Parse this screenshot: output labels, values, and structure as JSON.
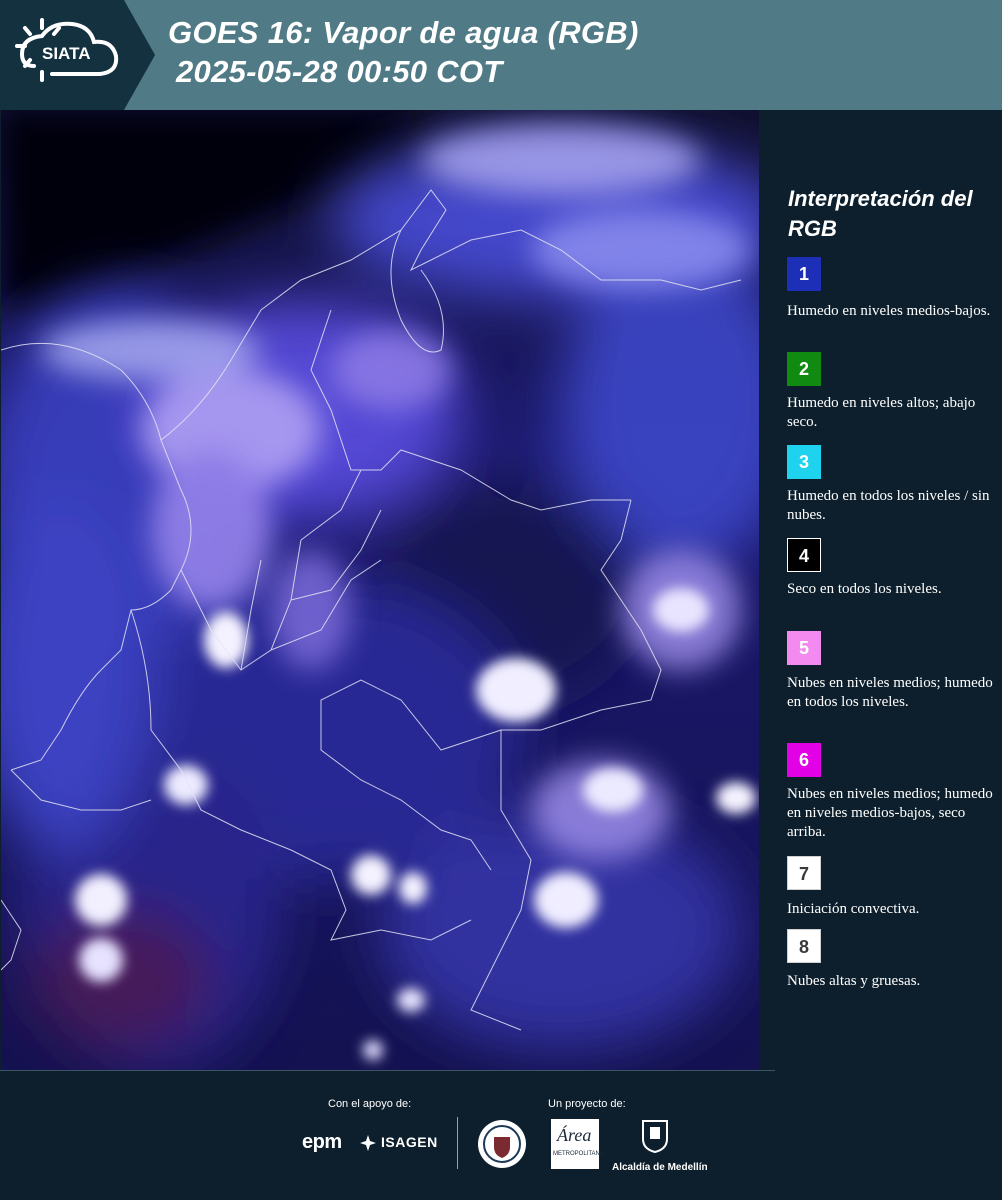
{
  "header": {
    "title_line1": "GOES 16: Vapor de agua (RGB)",
    "title_line2": "2025-05-28 00:50 COT",
    "logo_text": "SIATA"
  },
  "map": {
    "description_icon": "satellite-rgb-image"
  },
  "legend": {
    "title": "Interpretación del RGB",
    "items": [
      {
        "number": "1",
        "color": "#1c2fb6",
        "text": "Humedo en niveles medios-bajos."
      },
      {
        "number": "2",
        "color": "#108a10",
        "text": "Humedo en niveles altos; abajo seco."
      },
      {
        "number": "3",
        "color": "#1fd3ee",
        "text": "Humedo en todos los niveles / sin nubes."
      },
      {
        "number": "4",
        "color": "#000000",
        "text": "Seco en todos los niveles."
      },
      {
        "number": "5",
        "color": "#f28af0",
        "text": "Nubes en niveles medios; humedo en todos los niveles."
      },
      {
        "number": "6",
        "color": "#e200e6",
        "text": "Nubes en niveles medios; humedo en niveles medios-bajos, seco arriba."
      },
      {
        "number": "7",
        "color": "#ffffff",
        "text": "Iniciación convectiva."
      },
      {
        "number": "8",
        "color": "#ffffff",
        "text": "Nubes altas y gruesas."
      }
    ]
  },
  "footer": {
    "support_label": "Con el apoyo de:",
    "project_label": "Un proyecto de:",
    "epm": "epm",
    "isagen": "ISAGEN",
    "amva_text": "Área",
    "amva_sub": "METROPOLITANA",
    "medellin": "Alcaldía de Medellín"
  }
}
